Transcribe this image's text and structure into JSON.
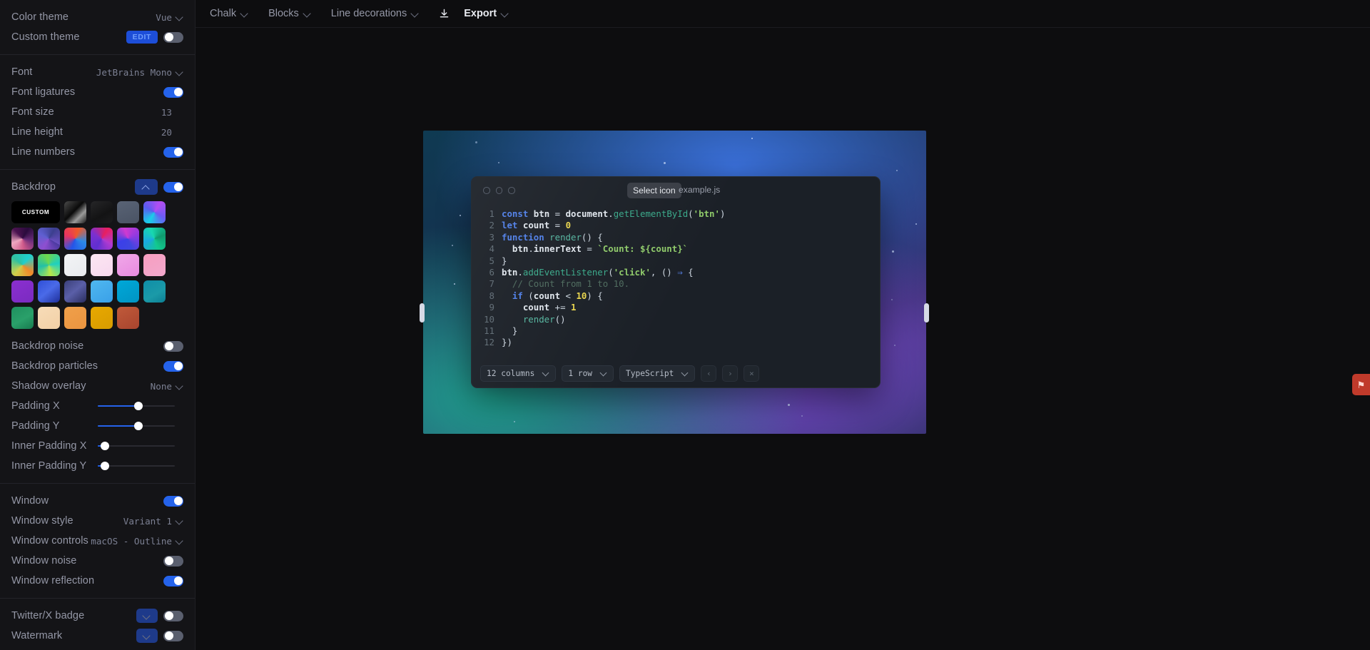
{
  "toolbar": {
    "items": [
      {
        "label": "Chalk",
        "chevron": true,
        "strong": false,
        "name": "menu-chalk"
      },
      {
        "label": "Blocks",
        "chevron": true,
        "strong": false,
        "name": "menu-blocks"
      },
      {
        "label": "Line decorations",
        "chevron": true,
        "strong": false,
        "name": "menu-line-decorations"
      }
    ],
    "download_icon": "download-icon",
    "export_label": "Export"
  },
  "sidebar": {
    "theme_section": [
      {
        "label": "Color theme",
        "type": "select",
        "value": "Vue",
        "name": "color-theme"
      },
      {
        "label": "Custom theme",
        "type": "edit-toggle",
        "button": "EDIT",
        "on": false,
        "name": "custom-theme"
      }
    ],
    "font_section": [
      {
        "label": "Font",
        "type": "select",
        "value": "JetBrains Mono",
        "name": "font"
      },
      {
        "label": "Font ligatures",
        "type": "toggle",
        "on": true,
        "name": "font-ligatures"
      },
      {
        "label": "Font size",
        "type": "number",
        "value": "13",
        "name": "font-size"
      },
      {
        "label": "Line height",
        "type": "number",
        "value": "20",
        "name": "line-height"
      },
      {
        "label": "Line numbers",
        "type": "toggle",
        "on": true,
        "name": "line-numbers"
      }
    ],
    "backdrop": {
      "label": "Backdrop",
      "collapsed": false,
      "on": true,
      "custom_label": "CUSTOM",
      "swatches": [
        "linear-gradient(135deg,#4a4a4a,#0a0a0a 45%,#9a9a9a 70%,#1a1a1a)",
        "linear-gradient(150deg,#262628,#131314 60%,#1c1c1e)",
        "linear-gradient(160deg,#596375,#4a5364)",
        "conic-gradient(from 210deg,#18d0e8,#5b5bf0,#b34ef0,#6b5bf5,#18d0e8)",
        "conic-gradient(from 30deg,#2a0b3d,#6b2d7a,#d05a8a,#efa8c0,#4b1350,#2a0b3d)",
        "conic-gradient(from 120deg,#4b3aa0,#8e4fd0,#5e5fd0,#3c3f8e,#6b4fc0)",
        "conic-gradient(from 200deg,#2455e8,#e8345f,#f05a2a,#2b8ae8,#2455e8)",
        "conic-gradient(from 300deg,#7b30d0,#e81f5f,#b03ad0,#5f2fd0,#7b30d0)",
        "conic-gradient(from 250deg,#3b3fe8,#d03ad0,#8f3ae0,#3e46e0,#3b3fe8)",
        "conic-gradient(from 160deg,#13c98e,#1aa8e0,#18d8b0,#0f9a6e,#13c98e)",
        "conic-gradient(from 40deg,#1fd0d0,#f08a2a,#d0d04a,#2fc0a0,#1fd0d0)",
        "conic-gradient(from 80deg,#1fd0c0,#b8e84a,#22c0a8,#6fd84a,#1fd0c0)",
        "linear-gradient(145deg,#f3f4f6,#e8eaee)",
        "linear-gradient(150deg,#fce6f2,#f7d8ee)",
        "linear-gradient(150deg,#f0a8e8,#e88ae0)",
        "linear-gradient(150deg,#f79ec0,#f2a8cc)",
        "linear-gradient(150deg,#8b2fd0,#7a2bc0)",
        "linear-gradient(140deg,#2f4fd8,#4a6ae8 48%,#1e2f9a)",
        "linear-gradient(140deg,#3a3f7a,#5a5fa8 48%,#2a2d5e)",
        "linear-gradient(150deg,#4fb8f0,#3aa0e8)",
        "linear-gradient(150deg,#00a8d8,#0094c4)",
        "linear-gradient(150deg,#0f8ea8,#1b9aa8 60%,#0c7f94)",
        "linear-gradient(150deg,#1f8f5e,#2aa06a 55%,#177a4e)",
        "linear-gradient(150deg,#f7dcb8,#f2d0a6)",
        "linear-gradient(150deg,#f0a04a,#ea9440)",
        "linear-gradient(150deg,#e8a800,#d89c00)",
        "linear-gradient(150deg,#c05a3a,#a8442e)"
      ]
    },
    "backdrop_section": [
      {
        "label": "Backdrop noise",
        "type": "toggle",
        "on": false,
        "name": "backdrop-noise"
      },
      {
        "label": "Backdrop particles",
        "type": "toggle",
        "on": true,
        "name": "backdrop-particles"
      },
      {
        "label": "Shadow overlay",
        "type": "select",
        "value": "None",
        "name": "shadow-overlay"
      },
      {
        "label": "Padding X",
        "type": "slider",
        "percent": 53,
        "name": "padding-x"
      },
      {
        "label": "Padding Y",
        "type": "slider",
        "percent": 53,
        "name": "padding-y"
      },
      {
        "label": "Inner Padding X",
        "type": "slider",
        "percent": 4,
        "name": "inner-padding-x"
      },
      {
        "label": "Inner Padding Y",
        "type": "slider",
        "percent": 4,
        "name": "inner-padding-y"
      }
    ],
    "window_section": [
      {
        "label": "Window",
        "type": "toggle",
        "on": true,
        "name": "window"
      },
      {
        "label": "Window style",
        "type": "select",
        "value": "Variant 1",
        "name": "window-style"
      },
      {
        "label": "Window controls",
        "type": "select",
        "value": "macOS - Outline",
        "name": "window-controls"
      },
      {
        "label": "Window noise",
        "type": "toggle",
        "on": false,
        "name": "window-noise"
      },
      {
        "label": "Window reflection",
        "type": "toggle",
        "on": true,
        "name": "window-reflection"
      }
    ],
    "badge_section": [
      {
        "label": "Twitter/X badge",
        "type": "collapse-toggle",
        "on": false,
        "name": "twitter-badge"
      },
      {
        "label": "Watermark",
        "type": "collapse-toggle",
        "on": false,
        "name": "watermark"
      }
    ]
  },
  "editor": {
    "tooltip": "Select icon",
    "filename": "example.js",
    "traffic_lights": 3,
    "lines": [
      {
        "n": "1",
        "tokens": [
          {
            "t": "const",
            "c": "kw"
          },
          {
            "t": " ",
            "c": "punc"
          },
          {
            "t": "btn",
            "c": "var"
          },
          {
            "t": " = ",
            "c": "punc"
          },
          {
            "t": "document",
            "c": "var"
          },
          {
            "t": ".",
            "c": "punc"
          },
          {
            "t": "getElementById",
            "c": "meth"
          },
          {
            "t": "(",
            "c": "punc"
          },
          {
            "t": "'btn'",
            "c": "str"
          },
          {
            "t": ")",
            "c": "punc"
          }
        ]
      },
      {
        "n": "2",
        "tokens": [
          {
            "t": "let",
            "c": "kw"
          },
          {
            "t": " ",
            "c": "punc"
          },
          {
            "t": "count",
            "c": "var"
          },
          {
            "t": " = ",
            "c": "punc"
          },
          {
            "t": "0",
            "c": "num"
          }
        ]
      },
      {
        "n": "3",
        "tokens": [
          {
            "t": "function",
            "c": "kw"
          },
          {
            "t": " ",
            "c": "punc"
          },
          {
            "t": "render",
            "c": "fn"
          },
          {
            "t": "() {",
            "c": "punc"
          }
        ]
      },
      {
        "n": "4",
        "tokens": [
          {
            "t": "  ",
            "c": "punc"
          },
          {
            "t": "btn",
            "c": "var"
          },
          {
            "t": ".",
            "c": "punc"
          },
          {
            "t": "innerText",
            "c": "var"
          },
          {
            "t": " = ",
            "c": "punc"
          },
          {
            "t": "`Count: ${count}`",
            "c": "str"
          }
        ]
      },
      {
        "n": "5",
        "tokens": [
          {
            "t": "}",
            "c": "punc"
          }
        ]
      },
      {
        "n": "6",
        "tokens": [
          {
            "t": "btn",
            "c": "var"
          },
          {
            "t": ".",
            "c": "punc"
          },
          {
            "t": "addEventListener",
            "c": "meth"
          },
          {
            "t": "(",
            "c": "punc"
          },
          {
            "t": "'click'",
            "c": "str"
          },
          {
            "t": ", () ",
            "c": "punc"
          },
          {
            "t": "⇒",
            "c": "kw2"
          },
          {
            "t": " {",
            "c": "punc"
          }
        ]
      },
      {
        "n": "7",
        "tokens": [
          {
            "t": "  // Count from 1 to 10.",
            "c": "cmt"
          }
        ]
      },
      {
        "n": "8",
        "tokens": [
          {
            "t": "  ",
            "c": "punc"
          },
          {
            "t": "if",
            "c": "kw"
          },
          {
            "t": " (",
            "c": "punc"
          },
          {
            "t": "count",
            "c": "var"
          },
          {
            "t": " < ",
            "c": "punc"
          },
          {
            "t": "10",
            "c": "num"
          },
          {
            "t": ") {",
            "c": "punc"
          }
        ]
      },
      {
        "n": "9",
        "tokens": [
          {
            "t": "    ",
            "c": "punc"
          },
          {
            "t": "count",
            "c": "var"
          },
          {
            "t": " += ",
            "c": "punc"
          },
          {
            "t": "1",
            "c": "num"
          }
        ]
      },
      {
        "n": "10",
        "tokens": [
          {
            "t": "    ",
            "c": "punc"
          },
          {
            "t": "render",
            "c": "fn"
          },
          {
            "t": "()",
            "c": "punc"
          }
        ]
      },
      {
        "n": "11",
        "tokens": [
          {
            "t": "  }",
            "c": "punc"
          }
        ]
      },
      {
        "n": "12",
        "tokens": [
          {
            "t": "})",
            "c": "punc"
          }
        ]
      }
    ],
    "footer": {
      "columns": "12 columns",
      "rows": "1 row",
      "language": "TypeScript",
      "prev": "‹",
      "next": "›",
      "close": "×"
    }
  },
  "colors": {
    "accent": "#2563eb",
    "sidebar_bg": "#141417",
    "canvas_bg": "#0d0d0f",
    "window_bg": "#1b2027",
    "edge_widget": "#c03a2b"
  }
}
